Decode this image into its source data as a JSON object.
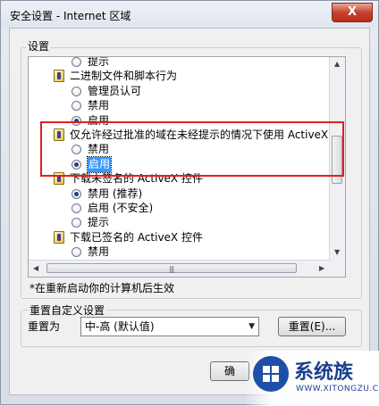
{
  "window": {
    "title": "安全设置 - Internet 区域",
    "close_label": "X"
  },
  "settings_group": {
    "label": "设置",
    "rows": [
      {
        "kind": "radio",
        "indent": 1,
        "label": "提示",
        "checked": false
      },
      {
        "kind": "category",
        "label": "二进制文件和脚本行为"
      },
      {
        "kind": "radio",
        "indent": 1,
        "label": "管理员认可",
        "checked": false
      },
      {
        "kind": "radio",
        "indent": 1,
        "label": "禁用",
        "checked": false
      },
      {
        "kind": "radio",
        "indent": 1,
        "label": "启用",
        "checked": true
      },
      {
        "kind": "category",
        "label": "仅允许经过批准的域在未经提示的情况下使用 ActiveX"
      },
      {
        "kind": "radio",
        "indent": 1,
        "label": "禁用",
        "checked": false
      },
      {
        "kind": "radio",
        "indent": 1,
        "label": "启用",
        "checked": true,
        "selected": true
      },
      {
        "kind": "category",
        "label": "下载未签名的 ActiveX 控件"
      },
      {
        "kind": "radio",
        "indent": 1,
        "label": "禁用 (推荐)",
        "checked": true
      },
      {
        "kind": "radio",
        "indent": 1,
        "label": "启用 (不安全)",
        "checked": false
      },
      {
        "kind": "radio",
        "indent": 1,
        "label": "提示",
        "checked": false
      },
      {
        "kind": "category",
        "label": "下载已签名的 ActiveX 控件"
      },
      {
        "kind": "radio",
        "indent": 1,
        "label": "禁用",
        "checked": false
      },
      {
        "kind": "radio",
        "indent": 1,
        "label": "启用 (不安全)",
        "checked": false
      }
    ]
  },
  "restart_note": "*在重新启动你的计算机后生效",
  "reset_group": {
    "label": "重置自定义设置",
    "reset_to_label": "重置为",
    "selected_level": "中-高 (默认值)",
    "reset_button": "重置(E)..."
  },
  "footer": {
    "ok_partial": "确"
  },
  "watermark": {
    "title": "系统族",
    "subtitle": "WWW.XITONGZU.COM"
  },
  "colors": {
    "highlight_border": "#e02020",
    "selection": "#3399ff"
  }
}
